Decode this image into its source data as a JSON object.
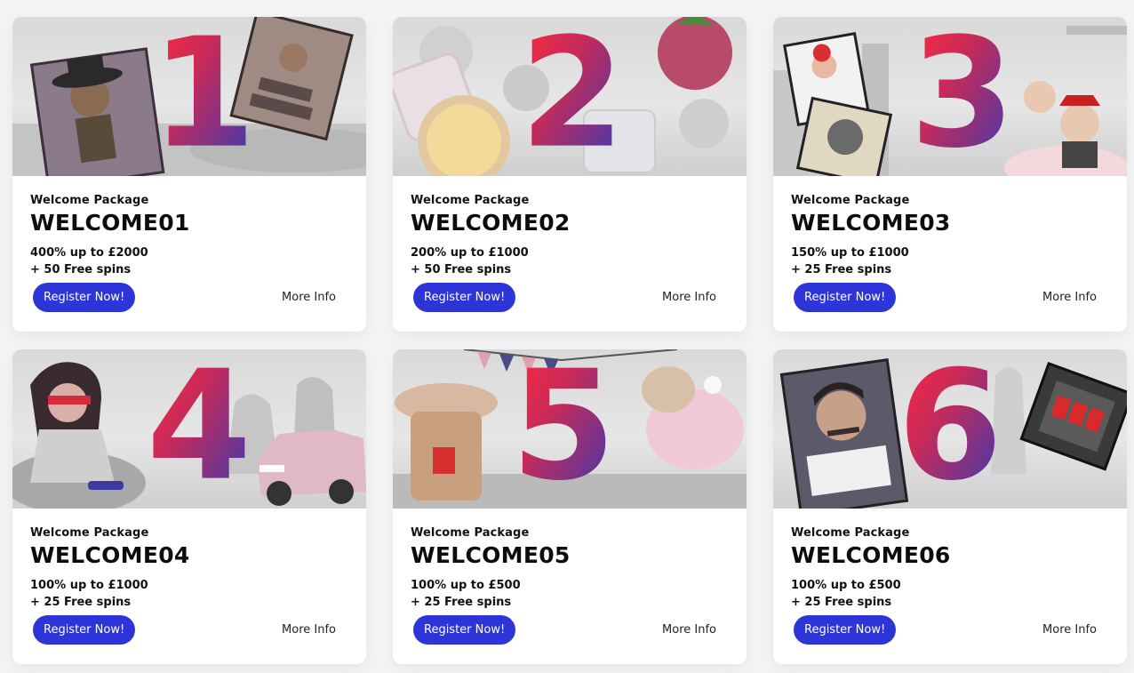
{
  "promos": [
    {
      "number": "1",
      "package_label": "Welcome Package",
      "code": "WELCOME01",
      "offer_line1": "400% up to £2000",
      "offer_line2": "+ 50 Free spins",
      "register_label": "Register Now!",
      "more_label": "More Info",
      "banner_theme": "wild-west"
    },
    {
      "number": "2",
      "package_label": "Welcome Package",
      "code": "WELCOME02",
      "offer_line1": "200% up to £1000",
      "offer_line2": "+ 50 Free spins",
      "register_label": "Register Now!",
      "more_label": "More Info",
      "banner_theme": "fruits"
    },
    {
      "number": "3",
      "package_label": "Welcome Package",
      "code": "WELCOME03",
      "offer_line1": "150% up to £1000",
      "offer_line2": "+ 25 Free spins",
      "register_label": "Register Now!",
      "more_label": "More Info",
      "banner_theme": "city-comic"
    },
    {
      "number": "4",
      "package_label": "Welcome Package",
      "code": "WELCOME04",
      "offer_line1": "100% up to £1000",
      "offer_line2": "+ 25 Free spins",
      "register_label": "Register Now!",
      "more_label": "More Info",
      "banner_theme": "retro-car"
    },
    {
      "number": "5",
      "package_label": "Welcome Package",
      "code": "WELCOME05",
      "offer_line1": "100% up to £500",
      "offer_line2": "+ 25 Free spins",
      "register_label": "Register Now!",
      "more_label": "More Info",
      "banner_theme": "fiesta"
    },
    {
      "number": "6",
      "package_label": "Welcome Package",
      "code": "WELCOME06",
      "offer_line1": "100% up to £500",
      "offer_line2": "+ 25 Free spins",
      "register_label": "Register Now!",
      "more_label": "More Info",
      "banner_theme": "narco"
    }
  ],
  "colors": {
    "button": "#2d35d8",
    "number_gradient_start": "#ff2a3a",
    "number_gradient_end": "#3a3ab0",
    "card_bg": "#ffffff",
    "page_bg": "#f4f4f6"
  }
}
